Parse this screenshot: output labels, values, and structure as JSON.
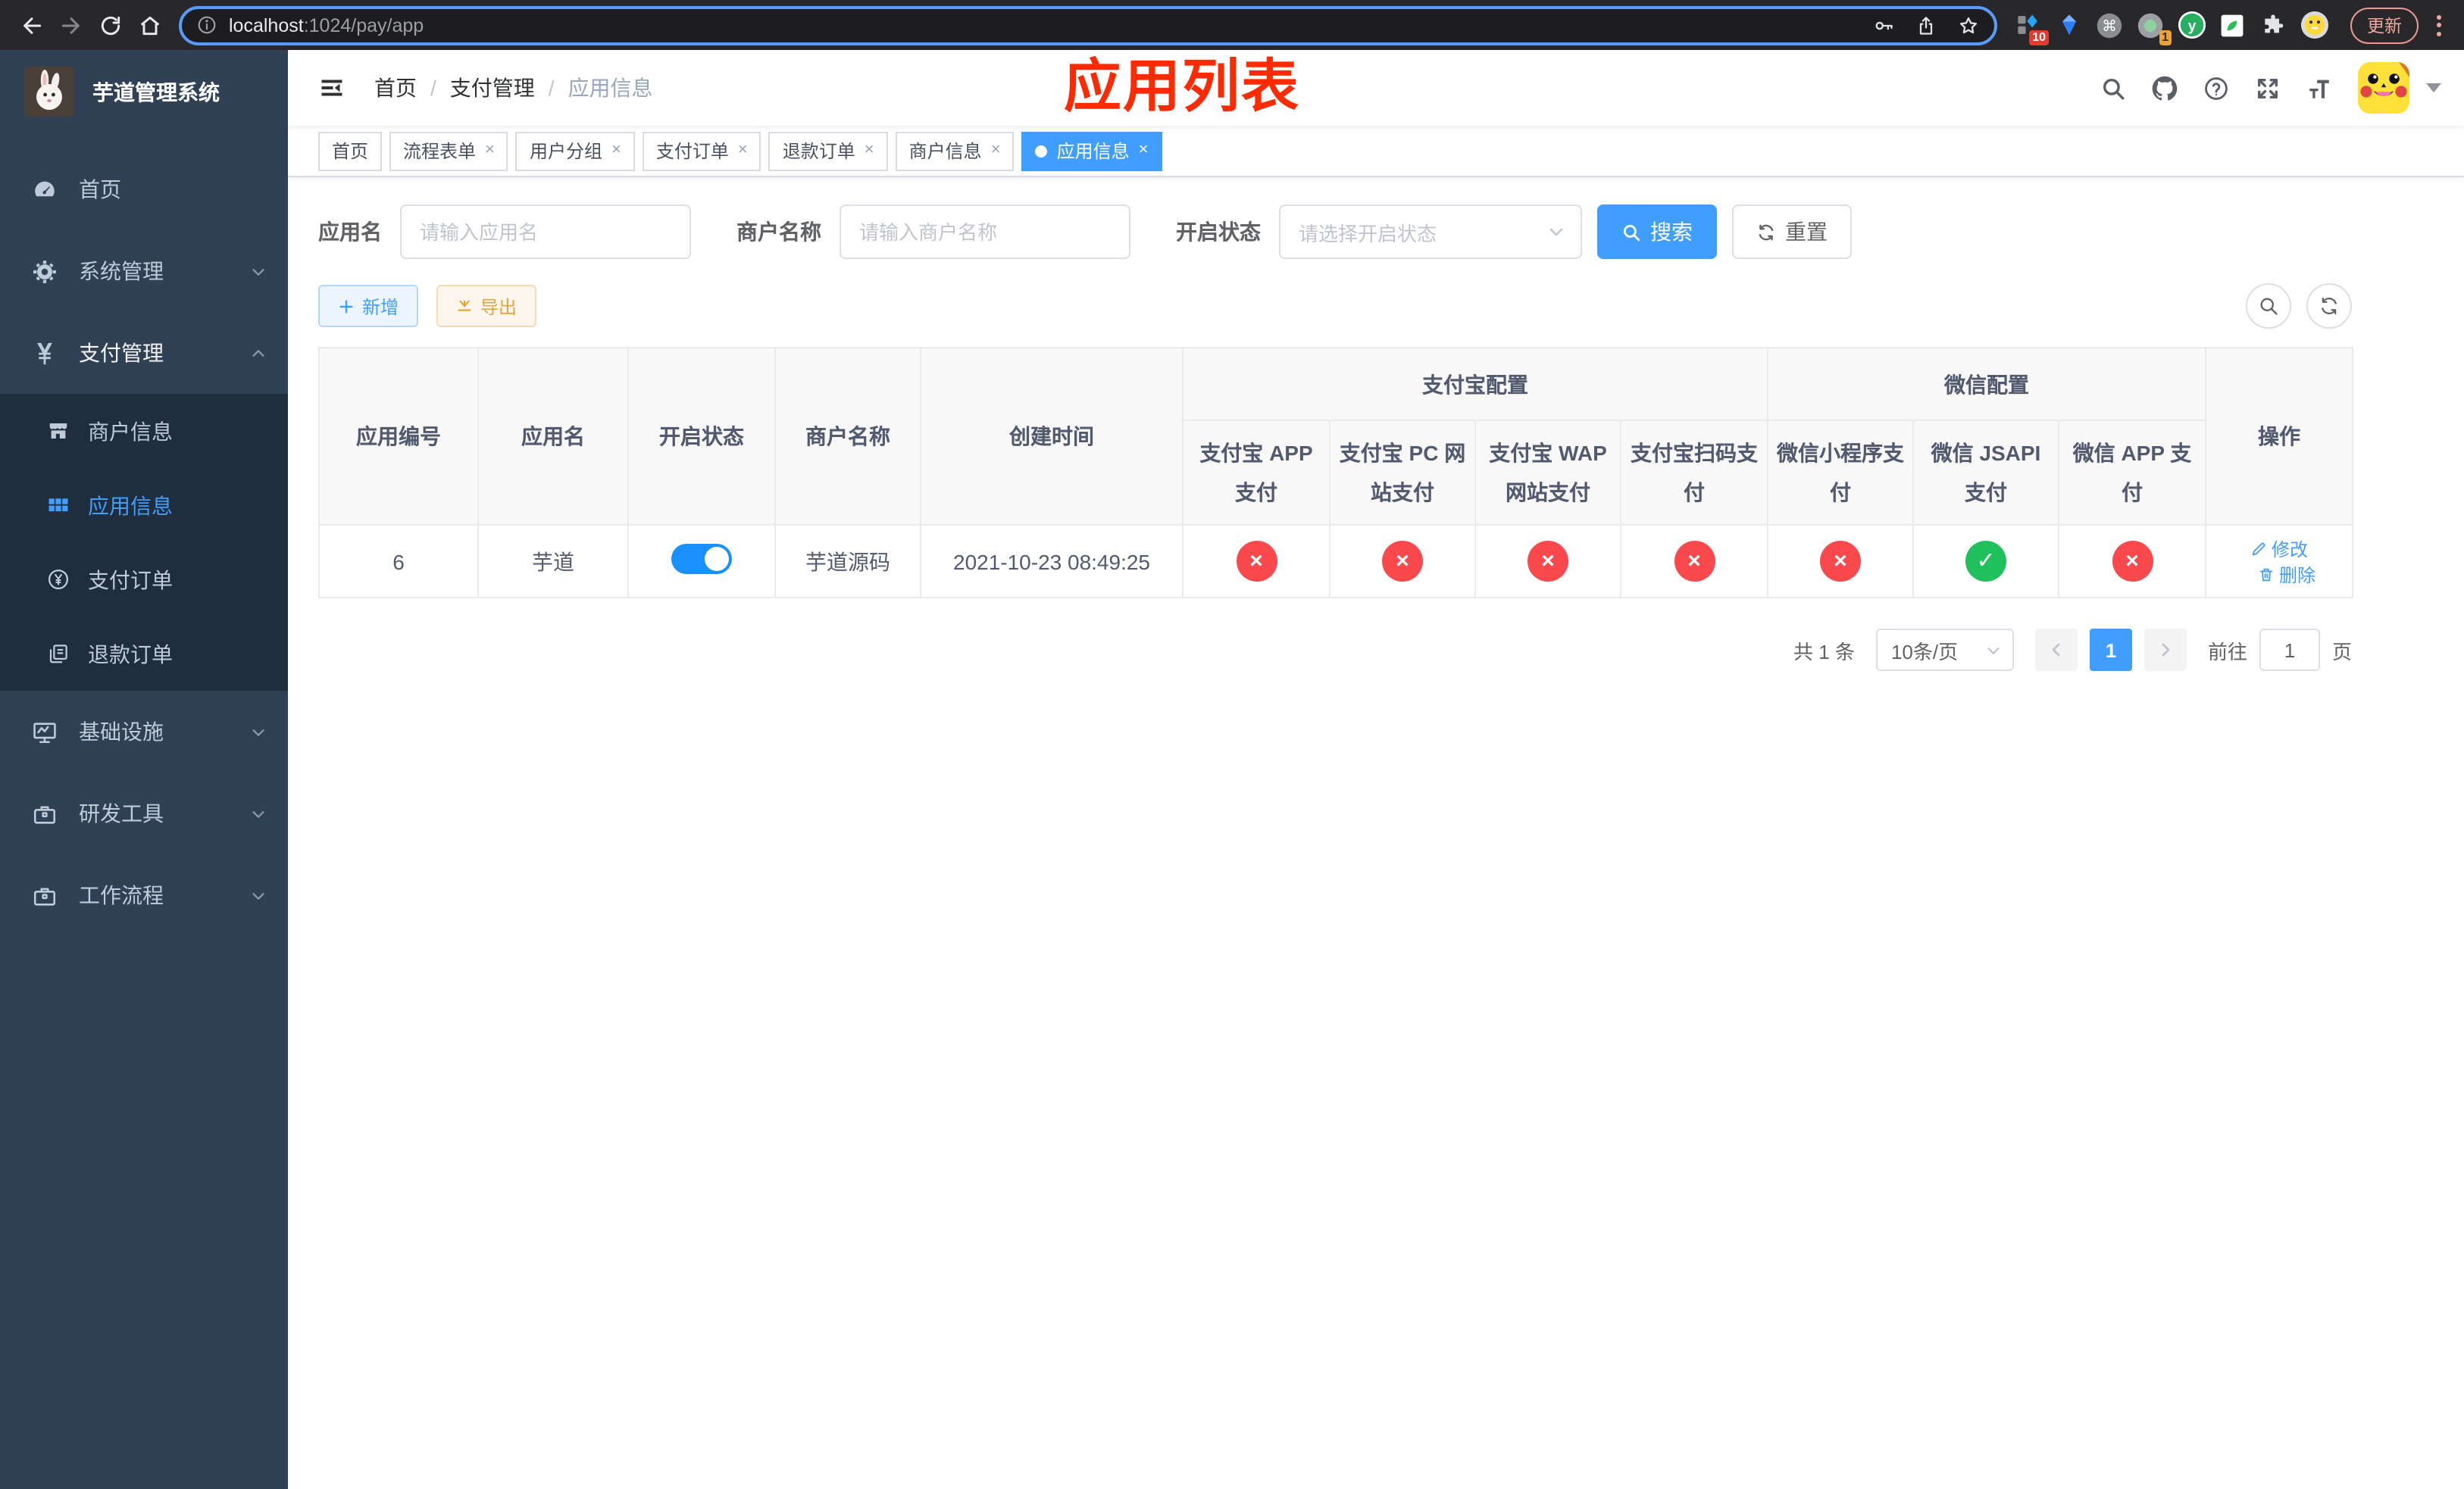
{
  "colors": {
    "accent": "#409eff",
    "sidebar_bg": "#304156",
    "submenu_bg": "#1f2d3d",
    "danger": "#f9494d",
    "success": "#20c05c",
    "warning": "#e6a23c",
    "annotation_red": "#fe2b02",
    "switch_on": "#1890ff"
  },
  "browser": {
    "url_host": "localhost",
    "url_port_path": ":1024/pay/app",
    "update_label": "更新",
    "ext_badge_1": "10",
    "ext_badge_2": "1"
  },
  "sidebar": {
    "title": "芋道管理系统",
    "menu": [
      {
        "label": "首页"
      },
      {
        "label": "系统管理"
      },
      {
        "label": "支付管理"
      },
      {
        "label": "商户信息"
      },
      {
        "label": "应用信息"
      },
      {
        "label": "支付订单"
      },
      {
        "label": "退款订单"
      },
      {
        "label": "基础设施"
      },
      {
        "label": "研发工具"
      },
      {
        "label": "工作流程"
      }
    ]
  },
  "navbar": {
    "breadcrumb": [
      "首页",
      "支付管理",
      "应用信息"
    ]
  },
  "annotation": {
    "title": "应用列表"
  },
  "tags": [
    {
      "label": "首页"
    },
    {
      "label": "流程表单"
    },
    {
      "label": "用户分组"
    },
    {
      "label": "支付订单"
    },
    {
      "label": "退款订单"
    },
    {
      "label": "商户信息"
    },
    {
      "label": "应用信息"
    }
  ],
  "filter": {
    "app_name_label": "应用名",
    "app_name_placeholder": "请输入应用名",
    "merchant_label": "商户名称",
    "merchant_placeholder": "请输入商户名称",
    "status_label": "开启状态",
    "status_placeholder": "请选择开启状态",
    "search_label": "搜索",
    "reset_label": "重置"
  },
  "toolbar": {
    "add_label": "新增",
    "export_label": "导出"
  },
  "table": {
    "headers": {
      "app_id": "应用编号",
      "app_name": "应用名",
      "status": "开启状态",
      "merchant": "商户名称",
      "create_time": "创建时间",
      "alipay_group": "支付宝配置",
      "wechat_group": "微信配置",
      "alipay_app": "支付宝 APP 支付",
      "alipay_pc": "支付宝 PC 网站支付",
      "alipay_wap": "支付宝 WAP 网站支付",
      "alipay_qr": "支付宝扫码支付",
      "wx_mini": "微信小程序支付",
      "wx_jsapi": "微信 JSAPI 支付",
      "wx_app": "微信 APP 支付",
      "actions": "操作"
    },
    "row": {
      "app_id": "6",
      "app_name": "芋道",
      "status_on": true,
      "merchant": "芋道源码",
      "create_time": "2021-10-23 08:49:25",
      "configs": [
        "cross",
        "cross",
        "cross",
        "cross",
        "cross",
        "check",
        "cross"
      ],
      "edit_label": "修改",
      "delete_label": "删除"
    }
  },
  "pagination": {
    "total": "共 1 条",
    "page_size": "10条/页",
    "page": "1",
    "goto_label": "前往",
    "goto_value": "1",
    "page_unit": "页"
  }
}
